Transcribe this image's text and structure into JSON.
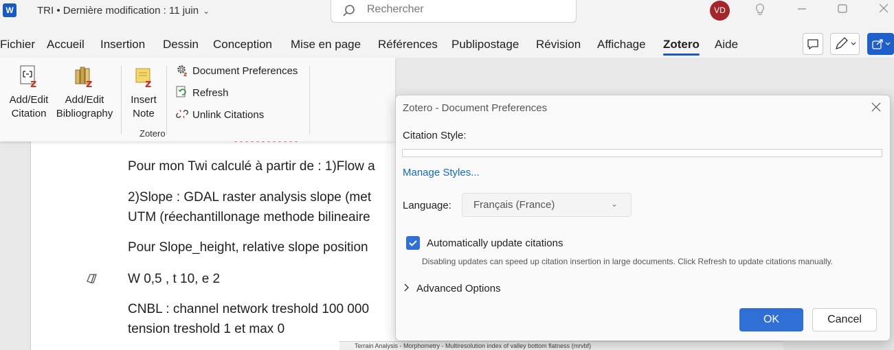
{
  "titlebar": {
    "app_icon": "word-icon",
    "doc_title": "TRI • Dernière modification : 11 juin",
    "search_placeholder": "Rechercher",
    "avatar_initials": "VD"
  },
  "menu": {
    "items": [
      "Fichier",
      "Accueil",
      "Insertion",
      "Dessin",
      "Conception",
      "Mise en page",
      "Références",
      "Publipostage",
      "Révision",
      "Affichage",
      "Zotero",
      "Aide"
    ],
    "active": "Zotero"
  },
  "ribbon": {
    "add_edit_citation": [
      "Add/Edit",
      "Citation"
    ],
    "add_edit_bibliography": [
      "Add/Edit",
      "Bibliography"
    ],
    "insert_note": [
      "Insert",
      "Note"
    ],
    "document_preferences": "Document Preferences",
    "refresh": "Refresh",
    "unlink_citations": "Unlink Citations",
    "group_label": "Zotero"
  },
  "document": {
    "lines": [
      "Pour mon Twi calculé à partir de : 1)Flow a",
      "2)Slope : GDAL raster analysis slope (met",
      "UTM (réechantillonage methode bilineaire",
      "Pour Slope_height, relative slope position",
      "W 0,5 , t 10, e 2",
      "CNBL : channel network treshold 100 000",
      "tension treshold 1 et max 0"
    ],
    "strip_text": "Terrain Analysis - Morphometry - Multiresolution index of valley bottom flatness (mrvbf)"
  },
  "dialog": {
    "title": "Zotero - Document Preferences",
    "citation_style_label": "Citation Style:",
    "manage_styles": "Manage Styles...",
    "language_label": "Language:",
    "language_value": "Français (France)",
    "auto_update_label": "Automatically update citations",
    "auto_update_checked": true,
    "hint": "Disabling updates can speed up citation insertion in large documents. Click Refresh to update citations manually.",
    "advanced_options": "Advanced Options",
    "ok": "OK",
    "cancel": "Cancel"
  }
}
